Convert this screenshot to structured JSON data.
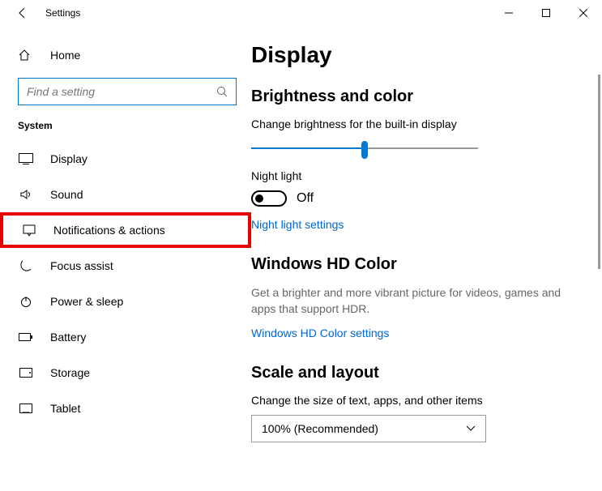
{
  "titlebar": {
    "title": "Settings"
  },
  "sidebar": {
    "home": "Home",
    "search_placeholder": "Find a setting",
    "section": "System",
    "items": [
      {
        "label": "Display"
      },
      {
        "label": "Sound"
      },
      {
        "label": "Notifications & actions"
      },
      {
        "label": "Focus assist"
      },
      {
        "label": "Power & sleep"
      },
      {
        "label": "Battery"
      },
      {
        "label": "Storage"
      },
      {
        "label": "Tablet"
      }
    ]
  },
  "content": {
    "heading": "Display",
    "brightness": {
      "title": "Brightness and color",
      "label": "Change brightness for the built-in display",
      "night_label": "Night light",
      "night_state": "Off",
      "night_link": "Night light settings"
    },
    "hd": {
      "title": "Windows HD Color",
      "desc": "Get a brighter and more vibrant picture for videos, games and apps that support HDR.",
      "link": "Windows HD Color settings"
    },
    "scale": {
      "title": "Scale and layout",
      "label": "Change the size of text, apps, and other items",
      "value": "100% (Recommended)"
    }
  }
}
